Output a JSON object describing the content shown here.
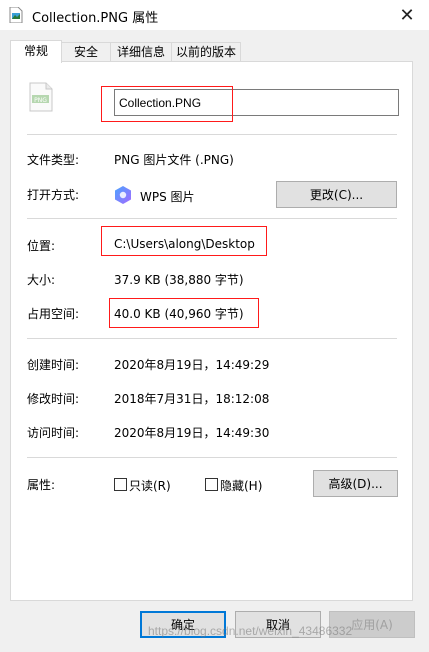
{
  "window": {
    "title": "Collection.PNG 属性",
    "close_glyph": "✕"
  },
  "tabs": [
    {
      "label": "常规",
      "active": true
    },
    {
      "label": "安全",
      "active": false
    },
    {
      "label": "详细信息",
      "active": false
    },
    {
      "label": "以前的版本",
      "active": false
    }
  ],
  "general": {
    "file_icon": "png-file-icon",
    "filename": "Collection.PNG",
    "file_type_label": "文件类型:",
    "file_type_value": "PNG 图片文件 (.PNG)",
    "opens_with_label": "打开方式:",
    "opens_with_app": "WPS 图片",
    "change_button": "更改(C)...",
    "location_label": "位置:",
    "location_value": "C:\\Users\\along\\Desktop",
    "size_label": "大小:",
    "size_value": "37.9 KB (38,880 字节)",
    "size_on_disk_label": "占用空间:",
    "size_on_disk_value": "40.0 KB (40,960 字节)",
    "created_label": "创建时间:",
    "created_value": "2020年8月19日，14:49:29",
    "modified_label": "修改时间:",
    "modified_value": "2018年7月31日，18:12:08",
    "accessed_label": "访问时间:",
    "accessed_value": "2020年8月19日，14:49:30",
    "attributes_label": "属性:",
    "readonly_label": "只读(R)",
    "readonly_checked": false,
    "hidden_label": "隐藏(H)",
    "hidden_checked": false,
    "advanced_button": "高级(D)..."
  },
  "footer": {
    "ok": "确定",
    "cancel": "取消",
    "apply": "应用(A)"
  },
  "watermark": "https://blog.csdn.net/weixin_43486332",
  "colors": {
    "highlight_box": "#ff1a1a",
    "default_button_border": "#0078d7"
  }
}
